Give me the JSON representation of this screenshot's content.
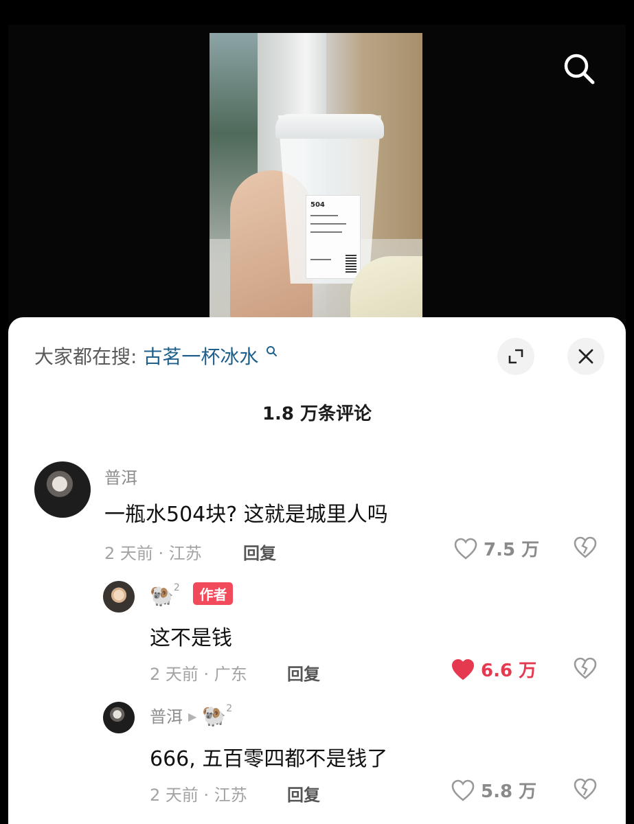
{
  "video": {
    "cup_label_number": "504"
  },
  "sheet": {
    "search_prefix": "大家都在搜",
    "search_colon": ":",
    "search_term": "古茗一杯冰水",
    "comment_count": "1.8 万条评论"
  },
  "comments": [
    {
      "author": "普洱",
      "text": "一瓶水504块? 这就是城里人吗",
      "time": "2 天前",
      "location": "江苏",
      "reply_label": "回复",
      "likes": "7.5 万",
      "liked": false
    },
    {
      "author": "🐏",
      "author_superscript": "2",
      "badge": "作者",
      "text": "这不是钱",
      "time": "2 天前",
      "location": "广东",
      "reply_label": "回复",
      "likes": "6.6 万",
      "liked": true
    },
    {
      "author": "普洱",
      "reply_to": "🐏",
      "reply_to_superscript": "2",
      "text": "666, 五百零四都不是钱了",
      "time": "2 天前",
      "location": "江苏",
      "reply_label": "回复",
      "likes": "5.8 万",
      "liked": false
    }
  ],
  "colors": {
    "accent_like": "#e5394f",
    "search_term": "#1f5f8b",
    "author_badge": "#f14a5b"
  },
  "icons": {
    "search": "search-icon",
    "expand": "expand-icon",
    "close": "close-icon",
    "like": "heart-icon",
    "dislike": "broken-heart-icon"
  }
}
